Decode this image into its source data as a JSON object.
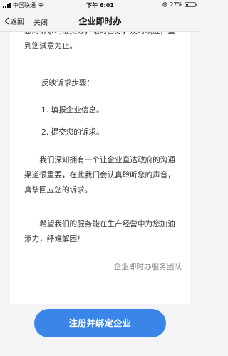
{
  "status_bar": {
    "carrier": "中国联通",
    "time": "下午 6:01",
    "battery_percent": "27%",
    "battery_level": 0.27
  },
  "nav": {
    "back_label": "返回",
    "close_label": "关闭",
    "title": "企业即时办"
  },
  "content": {
    "para1": "您的诉求精准交办，限时督办，及时响应，直到您满意为止。",
    "steps_heading": "反映诉求步骤：",
    "step1": "1. 填报企业信息。",
    "step2": "2. 提交您的诉求。",
    "para2": "我们深知拥有一个让企业直达政府的沟通渠道很重要，在此我们会认真聆听您的声音，真挚回应您的诉求。",
    "para3": "希望我们的服务能在生产经营中为您加油添力，纾难解困！",
    "signature": "企业即时办服务团队"
  },
  "actions": {
    "primary_label": "注册并绑定企业"
  },
  "colors": {
    "accent": "#3a86e8"
  }
}
